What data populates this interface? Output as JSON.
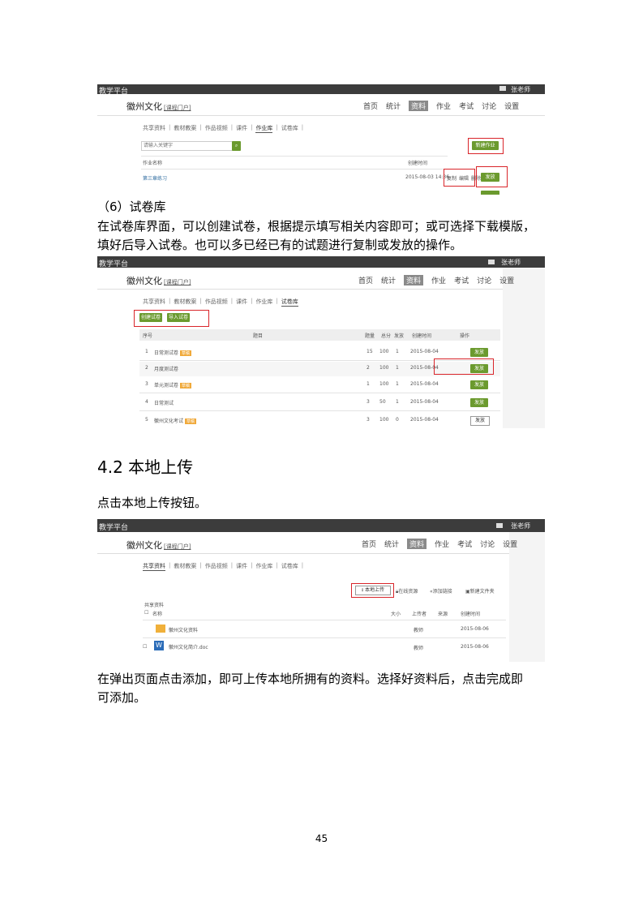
{
  "doc": {
    "section_6_heading": "（6）试卷库",
    "paragraph_1_line1": "在试卷库界面，可以创建试卷，根据提示填写相关内容即可；或可选择下载模版，",
    "paragraph_1_line2": "填好后导入试卷。也可以多已经已有的试题进行复制或发放的操作。",
    "section_42_heading": "4.2 本地上传",
    "paragraph_2": "点击本地上传按钮。",
    "paragraph_3_line1": "在弹出页面点击添加，即可上传本地所拥有的资料。选择好资料后，点击完成即",
    "paragraph_3_line2": "可添加。",
    "page_number": "45"
  },
  "shot1": {
    "brand": "教学平台",
    "user": "张老师",
    "app_title": "徽州文化",
    "app_title_sub": "[课程门户]",
    "nav": [
      "首页",
      "统计",
      "资料",
      "作业",
      "考试",
      "讨论",
      "设置"
    ],
    "nav_active": "资料",
    "tabs": [
      "共享资料",
      "教材教案",
      "作品视频",
      "课件",
      "作业库",
      "试卷库"
    ],
    "search_placeholder": "请输入关键字",
    "new_button": "新建作业",
    "columns": [
      "作业名称",
      "创建时间"
    ],
    "row_name": "第三章练习",
    "row_time": "2015-08-03 14:36",
    "row_actions": [
      "复制",
      "编辑",
      "删除"
    ],
    "row_button": "发放"
  },
  "shot2": {
    "brand": "教学平台",
    "user": "张老师",
    "app_title": "徽州文化",
    "app_title_sub": "[课程门户]",
    "nav": [
      "首页",
      "统计",
      "资料",
      "作业",
      "考试",
      "讨论",
      "设置"
    ],
    "nav_active": "资料",
    "tabs": [
      "共享资料",
      "教材教案",
      "作品视频",
      "课件",
      "作业库",
      "试卷库"
    ],
    "create_button": "创建试卷",
    "import_button": "导入试卷",
    "columns": [
      "序号",
      "题目",
      "题量",
      "总分",
      "发放",
      "创建时间",
      "操作"
    ],
    "rows": [
      {
        "no": "1",
        "title": "日常测试卷",
        "tag": "草稿",
        "count": "15",
        "score": "100",
        "sent": "1",
        "date": "2015-08-04",
        "action": "发放"
      },
      {
        "no": "2",
        "title": "月度测试卷",
        "tag": "",
        "count": "2",
        "score": "100",
        "sent": "1",
        "date": "2015-08-04",
        "action": "发放"
      },
      {
        "no": "3",
        "title": "单元测试卷",
        "tag": "草稿",
        "count": "1",
        "score": "100",
        "sent": "1",
        "date": "2015-08-04",
        "action": "发放"
      },
      {
        "no": "4",
        "title": "日常测试",
        "tag": "",
        "count": "3",
        "score": "50",
        "sent": "1",
        "date": "2015-08-04",
        "action": "发放"
      },
      {
        "no": "5",
        "title": "徽州文化考试",
        "tag": "草稿",
        "count": "3",
        "score": "100",
        "sent": "0",
        "date": "2015-08-04",
        "action": "发放"
      }
    ]
  },
  "shot3": {
    "brand": "教学平台",
    "user": "张老师",
    "app_title": "徽州文化",
    "app_title_sub": "[课程门户]",
    "nav": [
      "首页",
      "统计",
      "资料",
      "作业",
      "考试",
      "讨论",
      "设置"
    ],
    "nav_active": "资料",
    "tabs": [
      "共享资料",
      "教材教案",
      "作品视频",
      "课件",
      "作业库",
      "试卷库"
    ],
    "toolbar": [
      "本地上传",
      "在线资源",
      "添加链接",
      "新建文件夹"
    ],
    "breadcrumb": "共享资料",
    "columns": [
      "名称",
      "大小",
      "上传者",
      "来源",
      "创建时间"
    ],
    "rows": [
      {
        "name": "徽州文化资料",
        "size": "",
        "uploader": "教师",
        "source": "",
        "date": "2015-08-06"
      },
      {
        "name": "徽州文化简介.doc",
        "size": "",
        "uploader": "教师",
        "source": "",
        "date": "2015-08-06"
      }
    ]
  }
}
